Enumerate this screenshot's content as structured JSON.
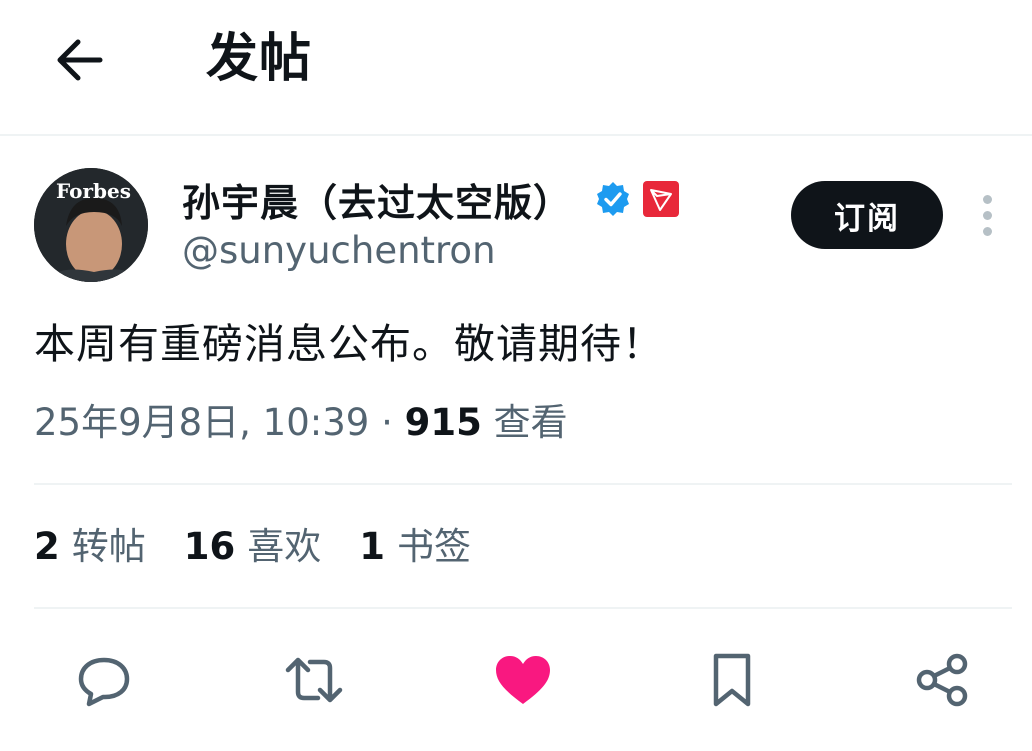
{
  "header": {
    "title": "发帖"
  },
  "author": {
    "name": "孙宇晨（去过太空版）",
    "handle": "@sunyuchentron",
    "avatar_text": "Forbes",
    "subscribe_label": "订阅"
  },
  "tweet": {
    "text": "本周有重磅消息公布。敬请期待！",
    "timestamp": "25年9月8日, 10:39",
    "separator": "·",
    "views_count": "915",
    "views_label": "查看"
  },
  "stats": {
    "retweets": {
      "count": "2",
      "label": "转帖"
    },
    "likes": {
      "count": "16",
      "label": "喜欢"
    },
    "bookmarks": {
      "count": "1",
      "label": "书签"
    }
  },
  "colors": {
    "text_primary": "#0f1419",
    "text_secondary": "#536471",
    "verified_blue": "#1d9bf0",
    "like_pink": "#f91880",
    "tron_red": "#e8283a",
    "divider": "#eff3f4"
  },
  "icons": [
    "back-arrow-icon",
    "verified-badge-icon",
    "tron-affiliate-icon",
    "more-dots-icon",
    "reply-icon",
    "retweet-icon",
    "like-heart-icon",
    "bookmark-icon",
    "share-icon"
  ]
}
